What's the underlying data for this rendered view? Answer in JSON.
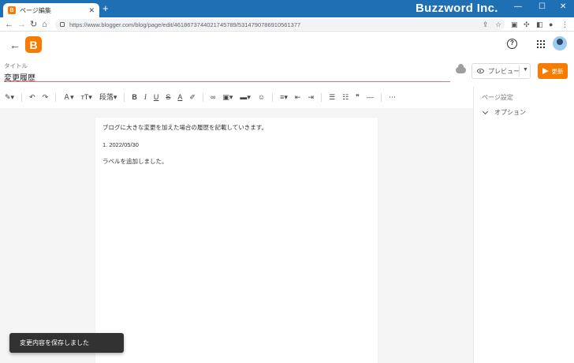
{
  "browser": {
    "tab_title": "ページ編集",
    "tab_favicon": "B",
    "tab_close": "✕",
    "new_tab": "+",
    "brand": "Buzzword Inc.",
    "window_controls": [
      "—",
      "☐",
      "✕"
    ],
    "url": "https://www.blogger.com/blog/page/edit/4618673744021745789/5314790786910561377"
  },
  "app": {
    "logo_letter": "B",
    "help_icon": "?"
  },
  "post": {
    "title_label": "タイトル",
    "title_value": "変更履歴"
  },
  "actions": {
    "preview_label": "プレビュー",
    "update_label": "更新"
  },
  "toolbar": {
    "paragraph_label": "段落"
  },
  "content": {
    "lines": [
      "ブログに大きな変更を加えた場合の履歴を記載していきます。",
      "1. 2022/05/30",
      "ラベルを追加しました。"
    ]
  },
  "side_panel": {
    "title": "ページ設定",
    "option_label": "オプション"
  },
  "snackbar": {
    "message": "変更内容を保存しました"
  },
  "colors": {
    "brand_orange": "#f57c00",
    "browser_blue": "#1f6fb5",
    "title_underline": "#e57373"
  }
}
